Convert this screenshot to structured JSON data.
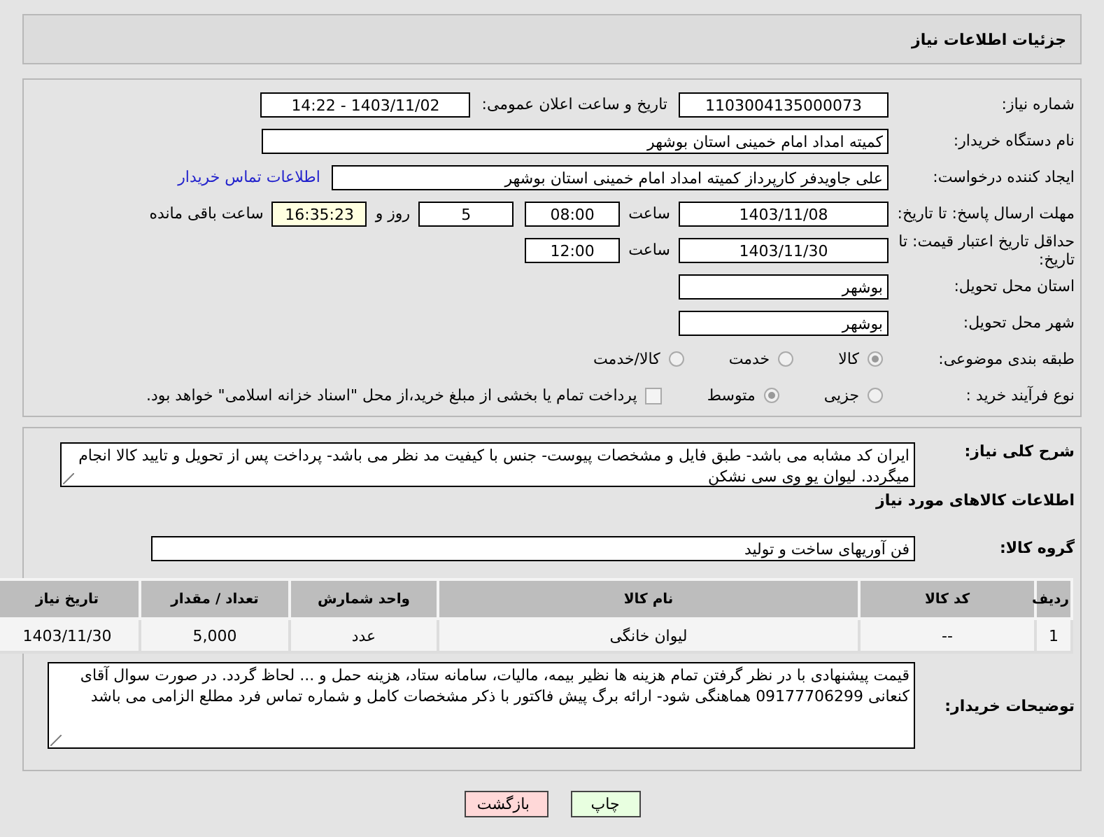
{
  "header": {
    "title": "جزئیات اطلاعات نیاز"
  },
  "need_number": {
    "label": "شماره نیاز:",
    "value": "1103004135000073"
  },
  "announce": {
    "label": "تاریخ و ساعت اعلان عمومی:",
    "value": "1403/11/02 - 14:22"
  },
  "buyer_org": {
    "label": "نام دستگاه خریدار:",
    "value": "کمیته امداد امام خمینی استان بوشهر"
  },
  "requester": {
    "label": "ایجاد کننده درخواست:",
    "value": "علی جاویدفر کارپرداز کمیته امداد امام خمینی استان بوشهر",
    "link": "اطلاعات تماس خریدار"
  },
  "deadline": {
    "label": "مهلت ارسال پاسخ: تا تاریخ:",
    "date": "1403/11/08",
    "time_label": "ساعت",
    "time": "08:00",
    "days": "5",
    "days_label": "روز و",
    "remaining": "16:35:23",
    "remaining_label": "ساعت باقی مانده"
  },
  "validity": {
    "label": "حداقل تاریخ اعتبار قیمت: تا تاریخ:",
    "date": "1403/11/30",
    "time_label": "ساعت",
    "time": "12:00"
  },
  "province": {
    "label": "استان محل تحویل:",
    "value": "بوشهر"
  },
  "city": {
    "label": "شهر محل تحویل:",
    "value": "بوشهر"
  },
  "category": {
    "label": "طبقه بندی موضوعی:",
    "options": [
      {
        "label": "کالا",
        "selected": true
      },
      {
        "label": "خدمت",
        "selected": false
      },
      {
        "label": "کالا/خدمت",
        "selected": false
      }
    ]
  },
  "process": {
    "label": "نوع فرآیند خرید :",
    "options": [
      {
        "label": "جزیی",
        "selected": false
      },
      {
        "label": "متوسط",
        "selected": true
      }
    ],
    "checkbox": {
      "label": "پرداخت تمام یا بخشی از مبلغ خرید،از محل \"اسناد خزانه اسلامی\" خواهد بود.",
      "checked": false
    }
  },
  "description": {
    "label": "شرح کلی نیاز:",
    "value": "ایران کد مشابه می باشد- طبق فایل و مشخصات پیوست- جنس با کیفیت مد نظر می باشد- پرداخت پس از تحویل و تایید کالا انجام میگردد. لیوان یو وی سی نشکن"
  },
  "goods_title": "اطلاعات کالاهای مورد نیاز",
  "goods_group": {
    "label": "گروه کالا:",
    "value": "فن آوریهای ساخت و تولید"
  },
  "table": {
    "columns": [
      "ردیف",
      "کد کالا",
      "نام کالا",
      "واحد شمارش",
      "تعداد / مقدار",
      "تاریخ نیاز"
    ],
    "rows": [
      [
        "1",
        "--",
        "لیوان خانگی",
        "عدد",
        "5,000",
        "1403/11/30"
      ]
    ]
  },
  "buyer_notes": {
    "label": "توضیحات خریدار:",
    "value": "قیمت پیشنهادی با در نظر گرفتن تمام هزینه ها نظیر بیمه، مالیات، سامانه ستاد، هزینه حمل و ... لحاظ گردد. در صورت سوال آقای کنعانی 09177706299 هماهنگی شود- ارائه برگ پیش فاکتور با ذکر مشخصات کامل و شماره تماس فرد مطلع الزامی می باشد"
  },
  "buttons": [
    {
      "label": "چاپ",
      "kind": "print"
    },
    {
      "label": "بازگشت",
      "kind": "back"
    }
  ]
}
